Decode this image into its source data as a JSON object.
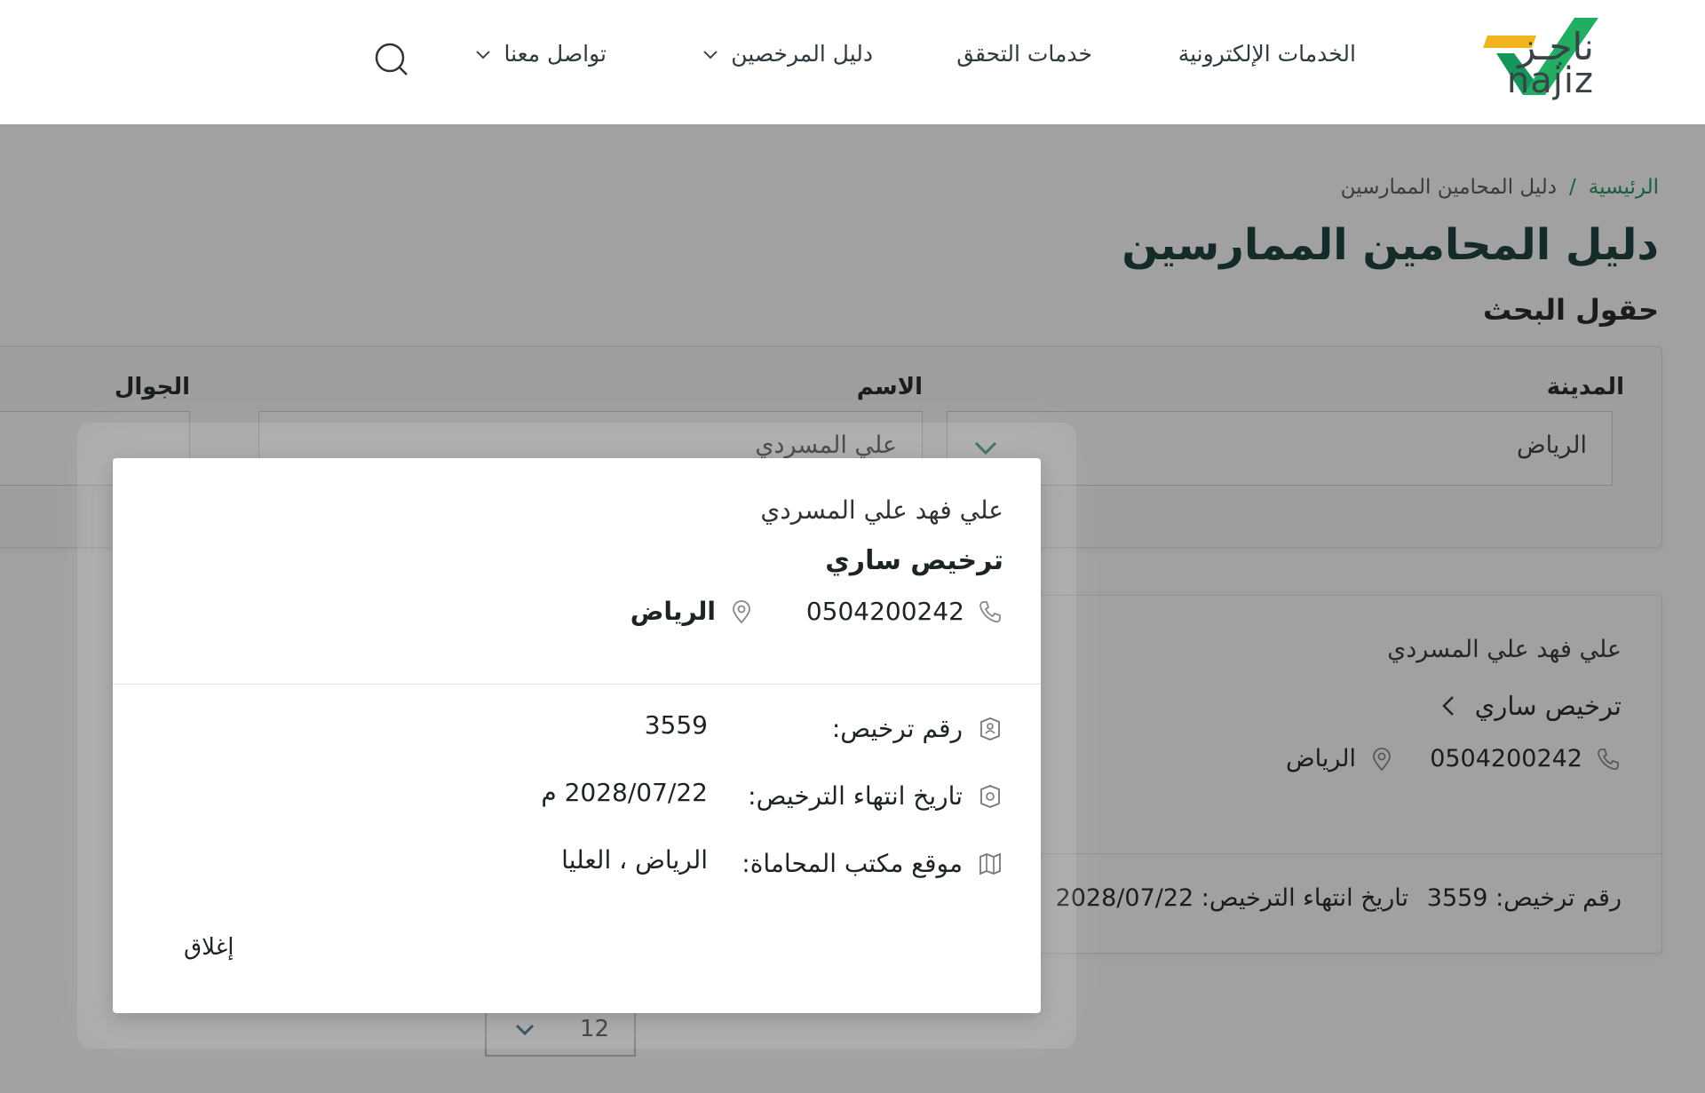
{
  "brand": {
    "name_ar": "ناجـز",
    "name_en": "najiz",
    "colors": {
      "green": "#1d9a5b",
      "yellow": "#f2b41e"
    }
  },
  "nav": {
    "items": [
      {
        "label": "الخدمات الإلكترونية"
      },
      {
        "label": "خدمات التحقق"
      },
      {
        "label": "دليل المرخصين"
      },
      {
        "label": "تواصل معنا"
      }
    ]
  },
  "breadcrumb": {
    "home": "الرئيسية",
    "separator": "/",
    "current": "دليل المحامين الممارسين"
  },
  "page": {
    "title": "دليل المحامين الممارسين",
    "section_title": "حقول البحث"
  },
  "search": {
    "city_label": "المدينة",
    "city_value": "الرياض",
    "name_label": "الاسم",
    "name_value": "علي المسردي",
    "mobile_label": "الجوال"
  },
  "result": {
    "name": "علي فهد علي المسردي",
    "status": "ترخيص ساري",
    "phone": "0504200242",
    "city": "الرياض",
    "license_text": "رقم ترخيص: 3559",
    "expiry_text": "تاريخ انتهاء الترخيص: 2028/07/22"
  },
  "pager": {
    "page_size": "12"
  },
  "modal": {
    "name": "علي فهد علي المسردي",
    "status": "ترخيص ساري",
    "phone": "0504200242",
    "city": "الرياض",
    "license_label": "رقم ترخيص:",
    "license_value": "3559",
    "expiry_label": "تاريخ انتهاء الترخيص:",
    "expiry_value": "2028/07/22 م",
    "office_label": "موقع مكتب المحاماة:",
    "office_value": "الرياض ، العليا",
    "close_label": "إغلاق"
  }
}
